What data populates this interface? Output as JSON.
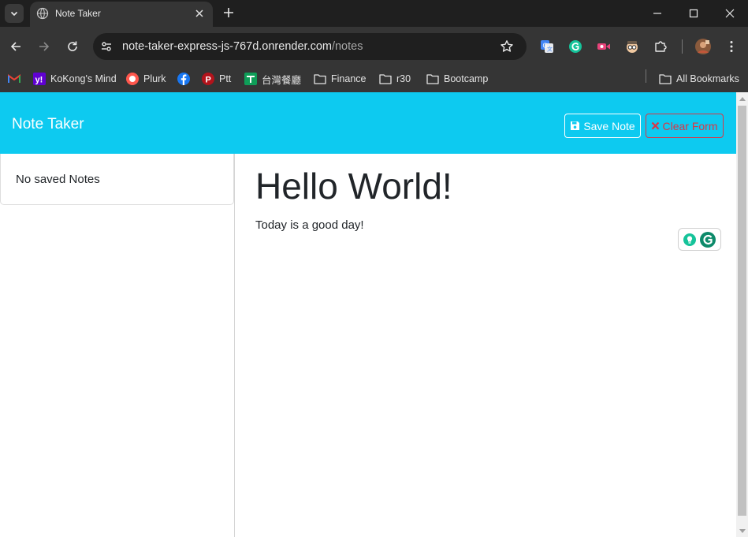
{
  "browser": {
    "tab": {
      "title": "Note Taker"
    },
    "address": {
      "host": "note-taker-express-js-767d.onrender.com",
      "path": "/notes"
    },
    "bookmarks": [
      {
        "label": "",
        "icon": "gmail-icon"
      },
      {
        "label": "KoKong's Mind",
        "icon": "yahoo-icon"
      },
      {
        "label": "Plurk",
        "icon": "plurk-icon"
      },
      {
        "label": "",
        "icon": "facebook-icon"
      },
      {
        "label": "Ptt",
        "icon": "ptt-icon"
      },
      {
        "label": "台灣餐廳",
        "icon": "table-icon"
      },
      {
        "label": "Finance",
        "icon": "folder-icon"
      },
      {
        "label": "r30",
        "icon": "folder-icon"
      },
      {
        "label": "Bootcamp",
        "icon": "folder-icon"
      },
      {
        "label": "All Bookmarks",
        "icon": "folder-icon"
      }
    ]
  },
  "app": {
    "brand": "Note Taker",
    "save_label": "Save Note",
    "clear_label": "Clear Form",
    "empty_list": "No saved Notes",
    "note": {
      "title": "Hello World!",
      "text": "Today is a good day!"
    }
  },
  "colors": {
    "navbar": "#0dcaf0",
    "danger": "#dc3545",
    "chrome_dark": "#1f1f1f",
    "chrome_toolbar": "#353535"
  }
}
